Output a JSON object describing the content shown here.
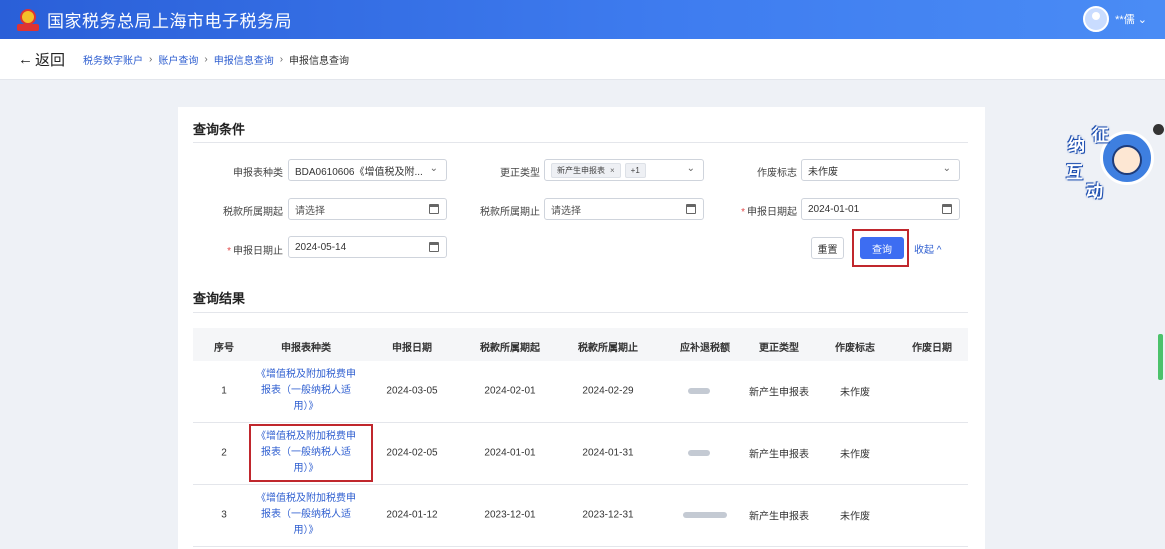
{
  "app": {
    "title": "国家税务总局上海市电子税务局",
    "username": "**儒"
  },
  "nav": {
    "back_label": "返回",
    "breadcrumbs": [
      "税务数字账户",
      "账户查询",
      "申报信息查询",
      "申报信息查询"
    ]
  },
  "query": {
    "title": "查询条件",
    "form_type": {
      "label": "申报表种类",
      "value": "BDA0610606《增值税及附..."
    },
    "correction_type": {
      "label": "更正类型",
      "tag": "新产生申报表",
      "more": "+1"
    },
    "void_flag": {
      "label": "作废标志",
      "value": "未作废"
    },
    "tax_period_start": {
      "label": "税款所属期起",
      "placeholder": "请选择"
    },
    "tax_period_end": {
      "label": "税款所属期止",
      "placeholder": "请选择"
    },
    "declare_date_start": {
      "label": "申报日期起",
      "value": "2024-01-01"
    },
    "declare_date_end": {
      "label": "申报日期止",
      "value": "2024-05-14"
    },
    "reset_label": "重置",
    "query_label": "查询",
    "collapse_label": "收起"
  },
  "results": {
    "title": "查询结果",
    "columns": [
      "序号",
      "申报表种类",
      "申报日期",
      "税款所属期起",
      "税款所属期止",
      "应补退税额",
      "更正类型",
      "作废标志",
      "作废日期"
    ],
    "rows": [
      {
        "no": "1",
        "form": "《增值税及附加税费申报表（一般纳税人适用）》",
        "declare_date": "2024-03-05",
        "period_start": "2024-02-01",
        "period_end": "2024-02-29",
        "correction": "新产生申报表",
        "void_flag": "未作废",
        "void_date": ""
      },
      {
        "no": "2",
        "form": "《增值税及附加税费申报表（一般纳税人适用）》",
        "declare_date": "2024-02-05",
        "period_start": "2024-01-01",
        "period_end": "2024-01-31",
        "correction": "新产生申报表",
        "void_flag": "未作废",
        "void_date": ""
      },
      {
        "no": "3",
        "form": "《增值税及附加税费申报表（一般纳税人适用）》",
        "declare_date": "2024-01-12",
        "period_start": "2023-12-01",
        "period_end": "2023-12-31",
        "correction": "新产生申报表",
        "void_flag": "未作废",
        "void_date": ""
      }
    ]
  },
  "widget": {
    "chars": [
      "纳",
      "征",
      "互",
      "动"
    ]
  },
  "colors": {
    "topbar": "#3a72e8",
    "primary": "#3d6df2",
    "link": "#2f5fd0",
    "highlight": "#c0272d"
  }
}
